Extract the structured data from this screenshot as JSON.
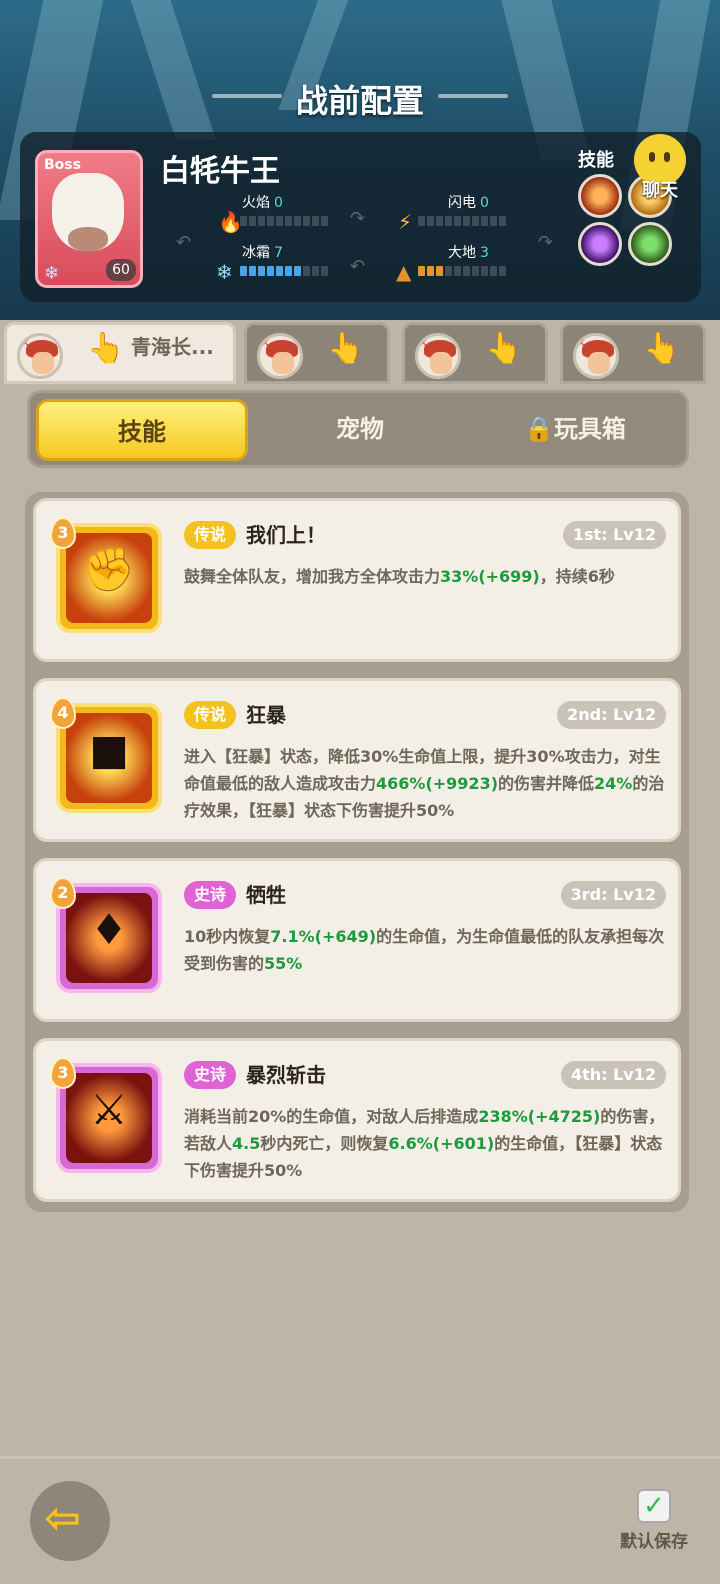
{
  "header": {
    "title": "战前配置"
  },
  "boss": {
    "tag": "Boss",
    "name": "白牦牛王",
    "level": "60",
    "elements": [
      {
        "label": "火焰",
        "value": "0",
        "level": 0,
        "max": 10,
        "color": "#e04a38"
      },
      {
        "label": "闪电",
        "value": "0",
        "level": 0,
        "max": 10,
        "color": "#f1c21f"
      },
      {
        "label": "冰霜",
        "value": "7",
        "level": 7,
        "max": 10,
        "color": "#47a6e8"
      },
      {
        "label": "大地",
        "value": "3",
        "level": 3,
        "max": 10,
        "color": "#e5922f"
      }
    ],
    "skills_label": "技能"
  },
  "chat": {
    "label": "聊天"
  },
  "hero_tabs": [
    {
      "name": "青海长..."
    },
    {
      "name": ""
    },
    {
      "name": ""
    },
    {
      "name": ""
    }
  ],
  "segments": {
    "skills": "技能",
    "pets": "宠物",
    "toybox": "玩具箱"
  },
  "cards": [
    {
      "badge": "3",
      "rarity": "传说",
      "name": "我们上！",
      "slot": "1st: Lv12",
      "desc_parts": [
        "鼓舞全体队友，增加我方全体攻击力",
        "33%(+699)",
        "，持续6秒"
      ]
    },
    {
      "badge": "4",
      "rarity": "传说",
      "name": "狂暴",
      "slot": "2nd: Lv12",
      "desc_parts": [
        "进入【狂暴】状态，降低30%生命值上限，提升30%攻击力，对生命值最低的敌人造成攻击力",
        "466%(+9923)",
        "的伤害并降低",
        "24%",
        "的治疗效果，【狂暴】状态下伤害提升50%"
      ]
    },
    {
      "badge": "2",
      "rarity": "史诗",
      "name": "牺牲",
      "slot": "3rd: Lv12",
      "desc_parts": [
        "10秒内恢复",
        "7.1%(+649)",
        "的生命值，为生命值最低的队友承担每次受到伤害的",
        "55%"
      ]
    },
    {
      "badge": "3",
      "rarity": "史诗",
      "name": "暴烈斩击",
      "slot": "4th: Lv12",
      "desc_parts": [
        "消耗当前20%的生命值，对敌人后排造成",
        "238%(+4725)",
        "的伤害，若敌人",
        "4.5",
        "秒内死亡，则恢复",
        "6.6%(+601)",
        "的生命值，【狂暴】状态下伤害提升50%"
      ]
    }
  ],
  "footer": {
    "save_label": "默认保存"
  }
}
